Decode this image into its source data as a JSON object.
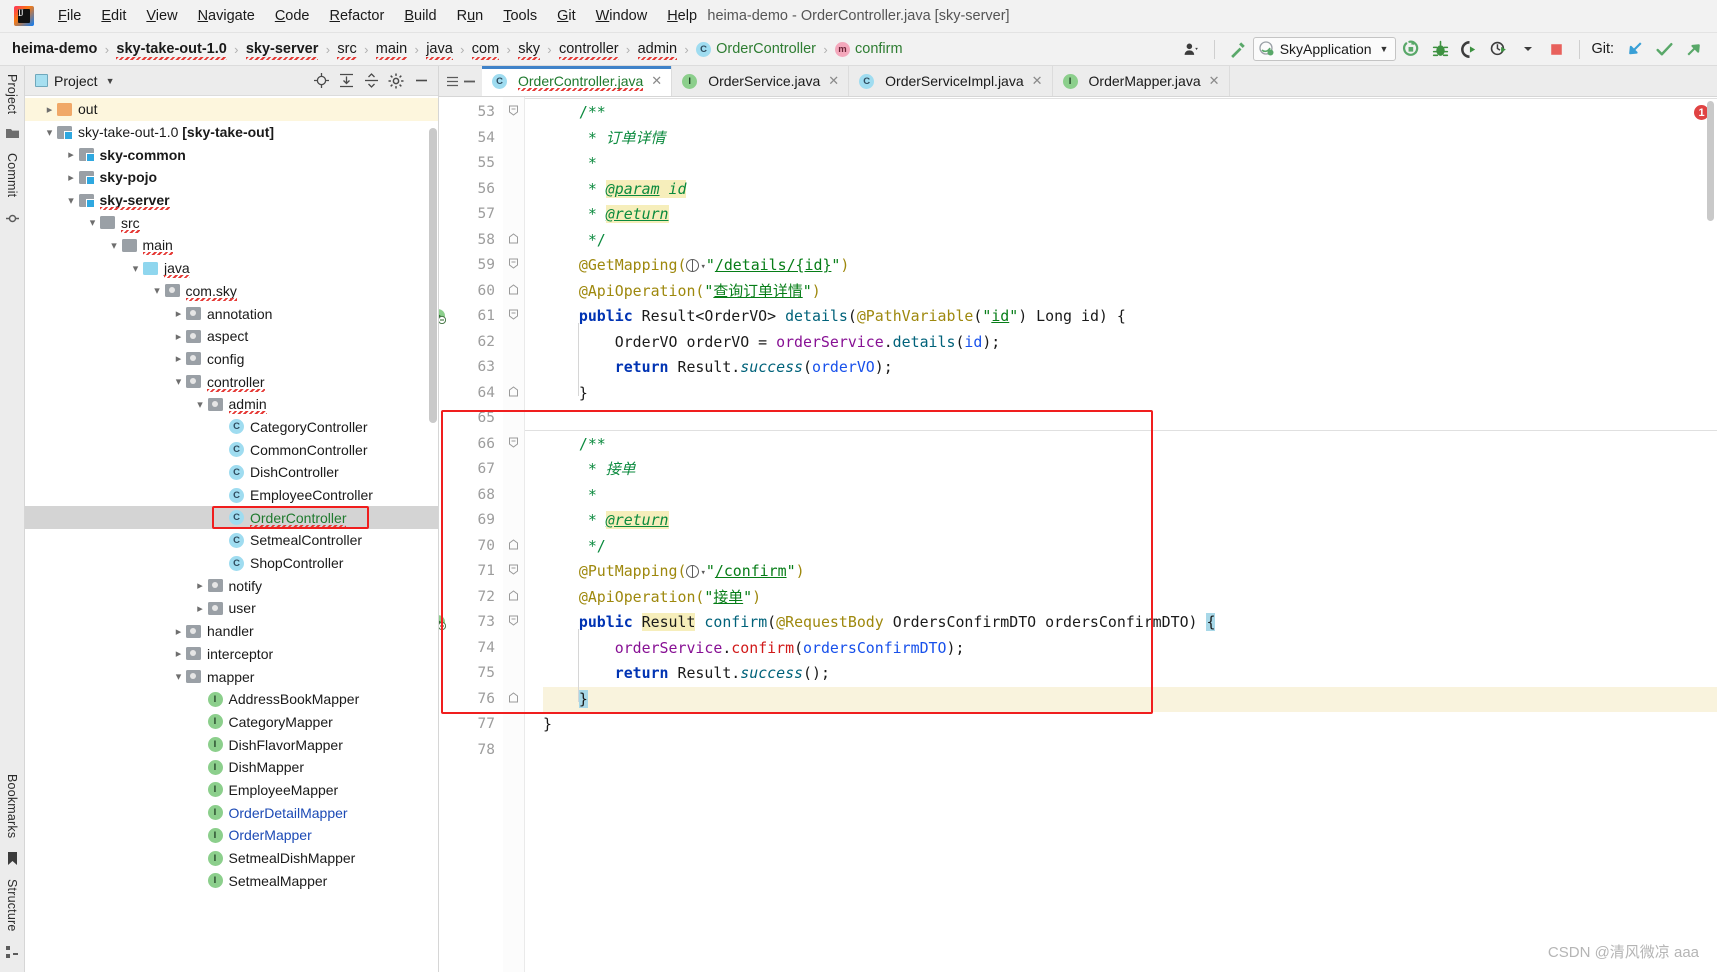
{
  "window": {
    "title": "heima-demo - OrderController.java [sky-server]",
    "logo_icon": "intellij-idea-logo"
  },
  "menubar": {
    "items": [
      {
        "label": "File",
        "mnemonic": "F"
      },
      {
        "label": "Edit",
        "mnemonic": "E"
      },
      {
        "label": "View",
        "mnemonic": "V"
      },
      {
        "label": "Navigate",
        "mnemonic": "N"
      },
      {
        "label": "Code",
        "mnemonic": "C"
      },
      {
        "label": "Refactor",
        "mnemonic": "R"
      },
      {
        "label": "Build",
        "mnemonic": "B"
      },
      {
        "label": "Run",
        "mnemonic": "u"
      },
      {
        "label": "Tools",
        "mnemonic": "T"
      },
      {
        "label": "Git",
        "mnemonic": "G"
      },
      {
        "label": "Window",
        "mnemonic": "W"
      },
      {
        "label": "Help",
        "mnemonic": "H"
      }
    ]
  },
  "navbar": {
    "breadcrumbs": [
      {
        "label": "heima-demo",
        "style": "bold"
      },
      {
        "label": "sky-take-out-1.0",
        "style": "bold"
      },
      {
        "label": "sky-server",
        "style": "bold"
      },
      {
        "label": "src",
        "style": "plain"
      },
      {
        "label": "main",
        "style": "plain"
      },
      {
        "label": "java",
        "style": "plain"
      },
      {
        "label": "com",
        "style": "plain"
      },
      {
        "label": "sky",
        "style": "plain"
      },
      {
        "label": "controller",
        "style": "plain"
      },
      {
        "label": "admin",
        "style": "plain"
      },
      {
        "label": "OrderController",
        "style": "green",
        "icon": "class-icon"
      },
      {
        "label": "confirm",
        "style": "green",
        "icon": "method-icon"
      }
    ],
    "separator": "›",
    "run_config": "SkyApplication",
    "run_config_icon": "spring-boot-icon",
    "git_label": "Git:",
    "toolbar_icons": [
      "user-avatar-icon",
      "hammer-build-icon",
      "run-icon",
      "debug-icon",
      "run-with-coverage-icon",
      "profiler-icon",
      "stop-icon",
      "git-update-icon",
      "git-commit-icon",
      "git-push-icon"
    ]
  },
  "left_rail": {
    "top": [
      "Project",
      "Commit"
    ],
    "bottom": [
      "Bookmarks",
      "Structure"
    ]
  },
  "project_panel": {
    "title": "Project",
    "view_icon": "project-view-icon",
    "tool_icons": [
      "locate-icon",
      "expand-all-icon",
      "collapse-all-icon",
      "settings-gear-icon",
      "hide-icon"
    ],
    "tree": [
      {
        "label": "out",
        "depth": 1,
        "arrow": "right",
        "icon": "folder-orange",
        "style": "plain",
        "highlight": "yellow"
      },
      {
        "label": "sky-take-out-1.0 [sky-take-out]",
        "depth": 1,
        "arrow": "down",
        "icon": "folder-module",
        "style": "module-root"
      },
      {
        "label": "sky-common",
        "depth": 2,
        "arrow": "right",
        "icon": "folder-module",
        "style": "bold"
      },
      {
        "label": "sky-pojo",
        "depth": 2,
        "arrow": "right",
        "icon": "folder-module",
        "style": "bold"
      },
      {
        "label": "sky-server",
        "depth": 2,
        "arrow": "down",
        "icon": "folder-module",
        "style": "bold-spell"
      },
      {
        "label": "src",
        "depth": 3,
        "arrow": "down",
        "icon": "folder-grey",
        "style": "spell"
      },
      {
        "label": "main",
        "depth": 4,
        "arrow": "down",
        "icon": "folder-grey",
        "style": "spell"
      },
      {
        "label": "java",
        "depth": 5,
        "arrow": "down",
        "icon": "folder-blue",
        "style": "spell"
      },
      {
        "label": "com.sky",
        "depth": 6,
        "arrow": "down",
        "icon": "folder-package",
        "style": "spell"
      },
      {
        "label": "annotation",
        "depth": 7,
        "arrow": "right",
        "icon": "folder-package",
        "style": "plain"
      },
      {
        "label": "aspect",
        "depth": 7,
        "arrow": "right",
        "icon": "folder-package",
        "style": "plain"
      },
      {
        "label": "config",
        "depth": 7,
        "arrow": "right",
        "icon": "folder-package",
        "style": "plain"
      },
      {
        "label": "controller",
        "depth": 7,
        "arrow": "down",
        "icon": "folder-package",
        "style": "spell"
      },
      {
        "label": "admin",
        "depth": 8,
        "arrow": "down",
        "icon": "folder-package",
        "style": "spell"
      },
      {
        "label": "CategoryController",
        "depth": 9,
        "arrow": "none",
        "icon": "class-icon",
        "style": "plain"
      },
      {
        "label": "CommonController",
        "depth": 9,
        "arrow": "none",
        "icon": "class-icon",
        "style": "plain"
      },
      {
        "label": "DishController",
        "depth": 9,
        "arrow": "none",
        "icon": "class-icon",
        "style": "plain"
      },
      {
        "label": "EmployeeController",
        "depth": 9,
        "arrow": "none",
        "icon": "class-icon",
        "style": "plain"
      },
      {
        "label": "OrderController",
        "depth": 9,
        "arrow": "none",
        "icon": "class-icon",
        "style": "green-spell",
        "highlight": "selected",
        "redbox": true
      },
      {
        "label": "SetmealController",
        "depth": 9,
        "arrow": "none",
        "icon": "class-icon",
        "style": "plain"
      },
      {
        "label": "ShopController",
        "depth": 9,
        "arrow": "none",
        "icon": "class-icon",
        "style": "plain"
      },
      {
        "label": "notify",
        "depth": 8,
        "arrow": "right",
        "icon": "folder-package",
        "style": "plain"
      },
      {
        "label": "user",
        "depth": 8,
        "arrow": "right",
        "icon": "folder-package",
        "style": "plain"
      },
      {
        "label": "handler",
        "depth": 7,
        "arrow": "right",
        "icon": "folder-package",
        "style": "plain"
      },
      {
        "label": "interceptor",
        "depth": 7,
        "arrow": "right",
        "icon": "folder-package",
        "style": "plain"
      },
      {
        "label": "mapper",
        "depth": 7,
        "arrow": "down",
        "icon": "folder-package",
        "style": "plain"
      },
      {
        "label": "AddressBookMapper",
        "depth": 8,
        "arrow": "none",
        "icon": "interface-icon",
        "style": "plain"
      },
      {
        "label": "CategoryMapper",
        "depth": 8,
        "arrow": "none",
        "icon": "interface-icon",
        "style": "plain"
      },
      {
        "label": "DishFlavorMapper",
        "depth": 8,
        "arrow": "none",
        "icon": "interface-icon",
        "style": "plain"
      },
      {
        "label": "DishMapper",
        "depth": 8,
        "arrow": "none",
        "icon": "interface-icon",
        "style": "plain"
      },
      {
        "label": "EmployeeMapper",
        "depth": 8,
        "arrow": "none",
        "icon": "interface-icon",
        "style": "plain"
      },
      {
        "label": "OrderDetailMapper",
        "depth": 8,
        "arrow": "none",
        "icon": "interface-icon",
        "style": "blue"
      },
      {
        "label": "OrderMapper",
        "depth": 8,
        "arrow": "none",
        "icon": "interface-icon",
        "style": "blue"
      },
      {
        "label": "SetmealDishMapper",
        "depth": 8,
        "arrow": "none",
        "icon": "interface-icon",
        "style": "plain"
      },
      {
        "label": "SetmealMapper",
        "depth": 8,
        "arrow": "none",
        "icon": "interface-icon",
        "style": "plain"
      }
    ]
  },
  "editor": {
    "tabs": [
      {
        "label": "OrderController.java",
        "icon": "class-icon",
        "active": true,
        "modified": true
      },
      {
        "label": "OrderService.java",
        "icon": "interface-icon",
        "active": false,
        "modified": false
      },
      {
        "label": "OrderServiceImpl.java",
        "icon": "class-icon",
        "active": false,
        "modified": false
      },
      {
        "label": "OrderMapper.java",
        "icon": "interface-icon",
        "active": false,
        "modified": false
      }
    ],
    "first_line_number": 53,
    "last_line_number": 78,
    "error_badge": "1",
    "lines": [
      {
        "n": 53,
        "text": "    /**",
        "fold": "start"
      },
      {
        "n": 54,
        "text": "     * 订单详情"
      },
      {
        "n": 55,
        "text": "     *"
      },
      {
        "n": 56,
        "text": "     * @param id"
      },
      {
        "n": 57,
        "text": "     * @return"
      },
      {
        "n": 58,
        "text": "     */",
        "fold": "end"
      },
      {
        "n": 59,
        "text": "    @GetMapping(\"/details/{id}\")",
        "fold": "start"
      },
      {
        "n": 60,
        "text": "    @ApiOperation(\"查询订单详情\")",
        "fold": "end"
      },
      {
        "n": 61,
        "text": "    public Result<OrderVO> details(@PathVariable(\"id\") Long id) {",
        "gutter": "run-icon",
        "fold": "start"
      },
      {
        "n": 62,
        "text": "        OrderVO orderVO = orderService.details(id);"
      },
      {
        "n": 63,
        "text": "        return Result.success(orderVO);"
      },
      {
        "n": 64,
        "text": "    }",
        "fold": "end"
      },
      {
        "n": 65,
        "text": ""
      },
      {
        "n": 66,
        "text": "    /**",
        "fold": "start"
      },
      {
        "n": 67,
        "text": "     * 接单"
      },
      {
        "n": 68,
        "text": "     *"
      },
      {
        "n": 69,
        "text": "     * @return"
      },
      {
        "n": 70,
        "text": "     */",
        "fold": "end"
      },
      {
        "n": 71,
        "text": "    @PutMapping(\"/confirm\")",
        "fold": "start"
      },
      {
        "n": 72,
        "text": "    @ApiOperation(\"接单\")",
        "fold": "end"
      },
      {
        "n": 73,
        "text": "    public Result confirm(@RequestBody OrdersConfirmDTO ordersConfirmDTO) {",
        "gutter": "run-icon",
        "fold": "start"
      },
      {
        "n": 74,
        "text": "        orderService.confirm(ordersConfirmDTO);"
      },
      {
        "n": 75,
        "text": "        return Result.success();"
      },
      {
        "n": 76,
        "text": "    }",
        "fold": "end",
        "caret": true
      },
      {
        "n": 77,
        "text": "}"
      },
      {
        "n": 78,
        "text": ""
      }
    ],
    "annotation_box": {
      "from_line": 65,
      "to_line": 76,
      "color": "#f01e1e"
    }
  },
  "watermark": "CSDN @清风微凉 aaa"
}
